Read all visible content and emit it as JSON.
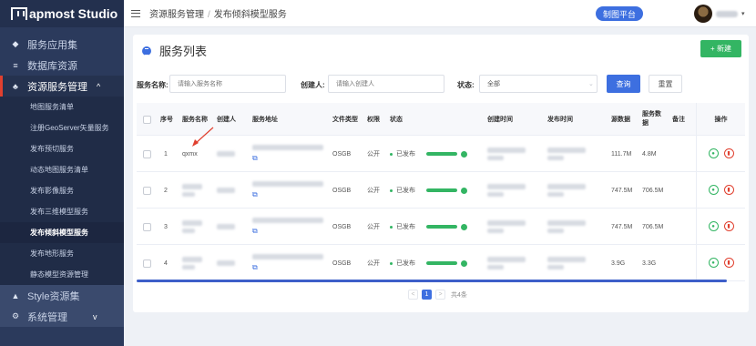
{
  "sidebar": {
    "brand": "apmost Studio",
    "items": [
      {
        "label": "服务应用集",
        "icon": "layers-icon"
      },
      {
        "label": "数据库资源",
        "icon": "database-icon"
      },
      {
        "label": "资源服务管理",
        "icon": "cluster-icon",
        "caret": "^"
      },
      {
        "label": "Style资源集",
        "icon": "style-icon"
      },
      {
        "label": "系统管理",
        "icon": "gear-icon",
        "caret": "v"
      }
    ],
    "sub_items": [
      "地图服务清单",
      "注册GeoServer矢量服务",
      "发布预切服务",
      "动态地图服务清单",
      "发布影像服务",
      "发布三维模型服务",
      "发布倾斜模型服务",
      "发布地形服务",
      "静态模型资源管理"
    ]
  },
  "topbar": {
    "crumb_parent": "资源服务管理",
    "crumb_sep": "/",
    "crumb_current": "发布倾斜模型服务",
    "platform_button": "制图平台",
    "user_caret": "▾"
  },
  "panel": {
    "title": "服务列表",
    "new_button": "+ 新建"
  },
  "filters": {
    "name_label": "服务名称:",
    "name_placeholder": "请输入服务名称",
    "creator_label": "创建人:",
    "creator_placeholder": "请输入创建人",
    "status_label": "状态:",
    "status_value": "全部",
    "query_button": "查询",
    "reset_button": "重置"
  },
  "table": {
    "headers": {
      "index": "序号",
      "name": "服务名称",
      "creator": "创建人",
      "address": "服务地址",
      "file_type": "文件类型",
      "permission": "权限",
      "status": "状态",
      "created": "创建时间",
      "published": "发布时间",
      "source_data": "源数据",
      "service_data": "服务数据",
      "note": "备注",
      "ops": "操作"
    },
    "rows": [
      {
        "index": "1",
        "name": "qxmx",
        "file_type": "OSGB",
        "permission": "公开",
        "status": "已发布",
        "progress": 1.0,
        "source_data": "111.7M",
        "service_data": "4.8M"
      },
      {
        "index": "2",
        "name": "",
        "file_type": "OSGB",
        "permission": "公开",
        "status": "已发布",
        "progress": 1.0,
        "source_data": "747.5M",
        "service_data": "706.5M"
      },
      {
        "index": "3",
        "name": "",
        "file_type": "OSGB",
        "permission": "公开",
        "status": "已发布",
        "progress": 1.0,
        "source_data": "747.5M",
        "service_data": "706.5M"
      },
      {
        "index": "4",
        "name": "",
        "file_type": "OSGB",
        "permission": "公开",
        "status": "已发布",
        "progress": 1.0,
        "source_data": "3.9G",
        "service_data": "3.3G"
      }
    ]
  },
  "pagination": {
    "prev": "<",
    "current": "1",
    "next": ">",
    "total": "共4条"
  },
  "colors": {
    "sidebar": "#2b3a5c",
    "accent": "#3d6fe0",
    "success": "#33b563",
    "danger": "#e0402f"
  }
}
